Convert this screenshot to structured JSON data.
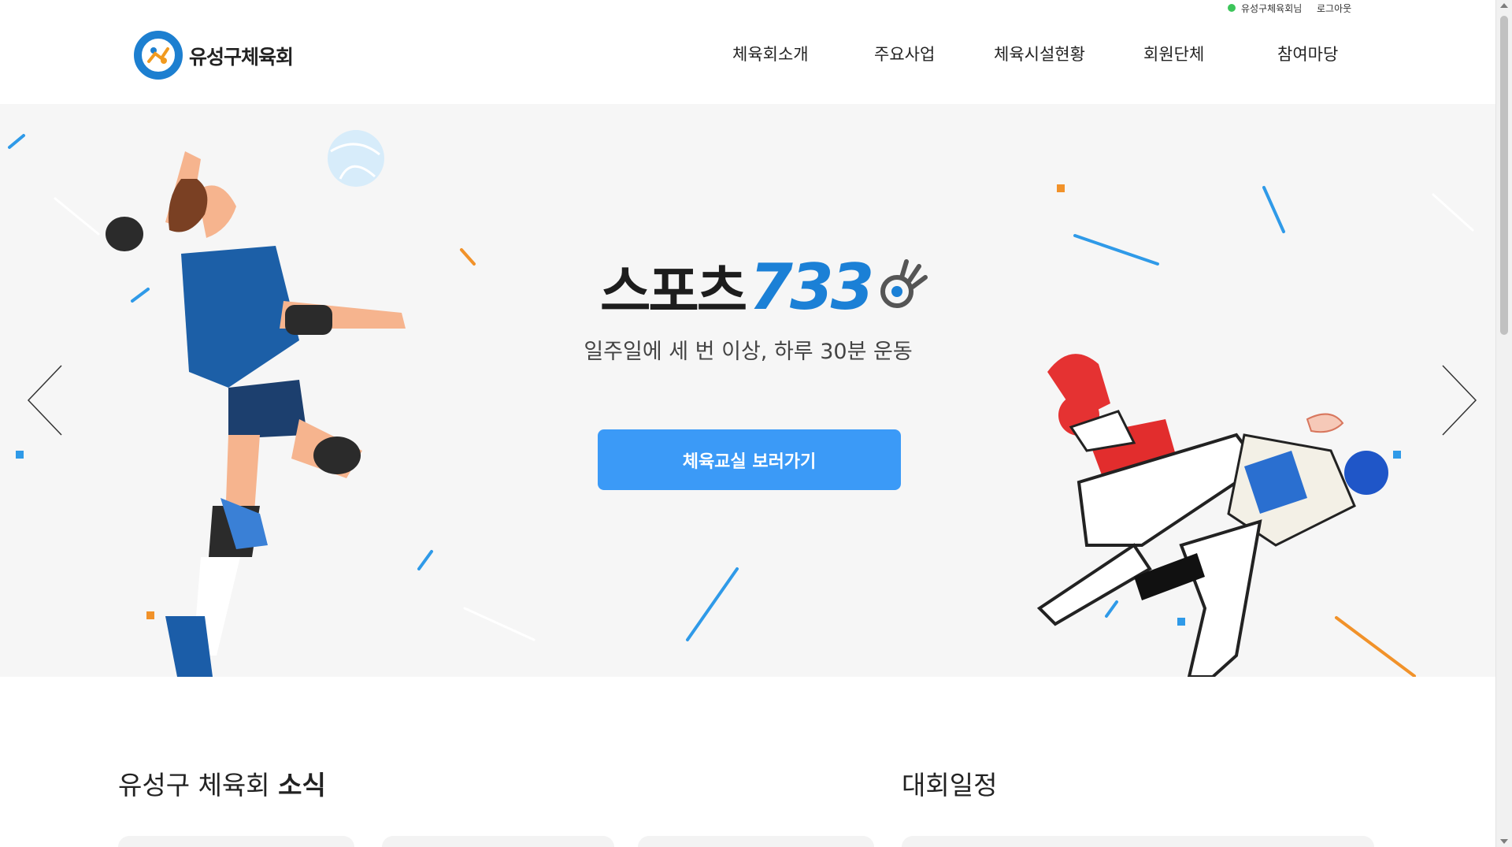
{
  "top_bar": {
    "user_name": "유성구체육회님",
    "logout": "로그아웃"
  },
  "header": {
    "logo_text": "유성구체육회",
    "nav": [
      "체육회소개",
      "주요사업",
      "체육시설현황",
      "회원단체",
      "참여마당"
    ]
  },
  "hero": {
    "brand_korean": "스포츠",
    "brand_number": "733",
    "tagline": "일주일에 세 번 이상, 하루 30분 운동",
    "cta_label": "체육교실 보러가기"
  },
  "sections": {
    "news_title_plain": "유성구 체육회 ",
    "news_title_bold": "소식",
    "schedule_title": "대회일정"
  },
  "colors": {
    "accent": "#3b9af7",
    "brand_blue": "#1b80d6",
    "hero_bg": "#f6f6f6",
    "online_status": "#3cc55a"
  },
  "icons": [
    "prev-arrow-icon",
    "next-arrow-icon",
    "ok-hand-icon",
    "logo-emblem",
    "online-status-icon"
  ]
}
